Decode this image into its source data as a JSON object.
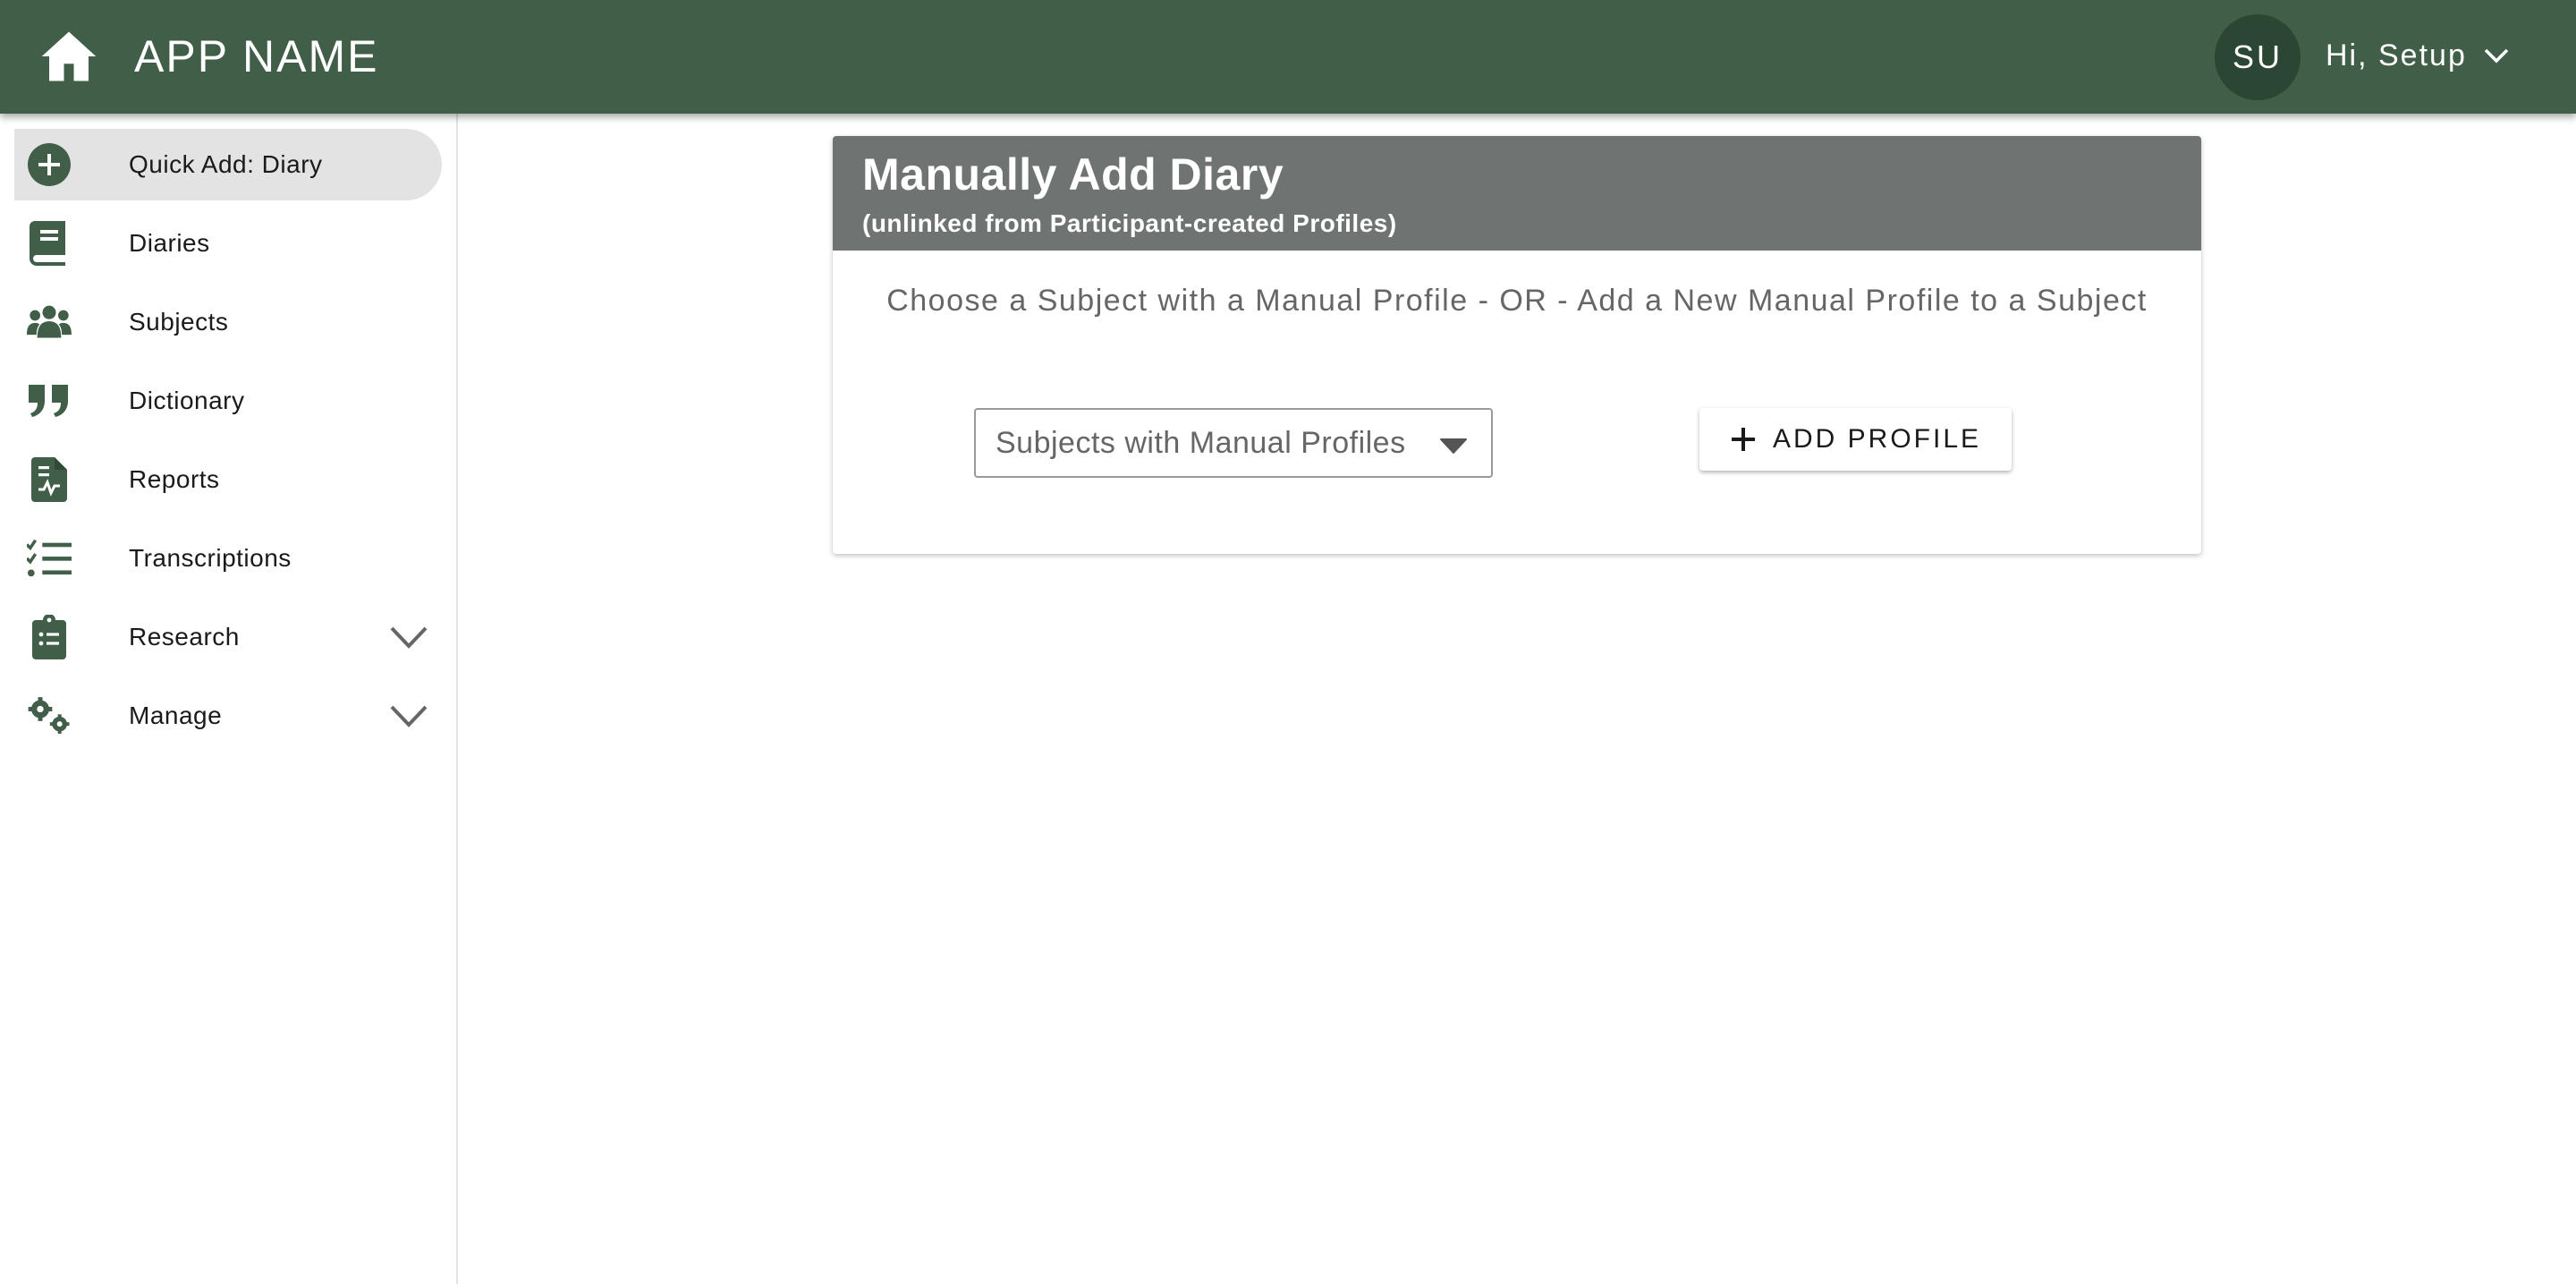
{
  "header": {
    "app_title": "APP NAME",
    "avatar_initials": "SU",
    "greeting": "Hi, Setup",
    "home_icon": "home-icon",
    "menu_icon": "chevron-down-icon"
  },
  "sidebar": {
    "items": [
      {
        "label": "Quick Add: Diary",
        "icon": "plus-circle-icon",
        "active": true
      },
      {
        "label": "Diaries",
        "icon": "book-icon"
      },
      {
        "label": "Subjects",
        "icon": "users-icon"
      },
      {
        "label": "Dictionary",
        "icon": "quote-icon"
      },
      {
        "label": "Reports",
        "icon": "report-icon"
      },
      {
        "label": "Transcriptions",
        "icon": "checklist-icon"
      },
      {
        "label": "Research",
        "icon": "clipboard-list-icon",
        "expandable": true
      },
      {
        "label": "Manage",
        "icon": "gears-icon",
        "expandable": true
      }
    ]
  },
  "card": {
    "title": "Manually Add Diary",
    "subtitle": "(unlinked from Participant-created Profiles)",
    "instructions": "Choose a Subject with a Manual Profile - OR - Add a New Manual Profile to a Subject",
    "select_placeholder": "Subjects with Manual Profiles",
    "add_button_label": "ADD PROFILE"
  },
  "colors": {
    "brand_green": "#405e48",
    "avatar_green": "#2b4733",
    "header_gray": "#6f7472",
    "active_bg": "#e3e3e3"
  }
}
